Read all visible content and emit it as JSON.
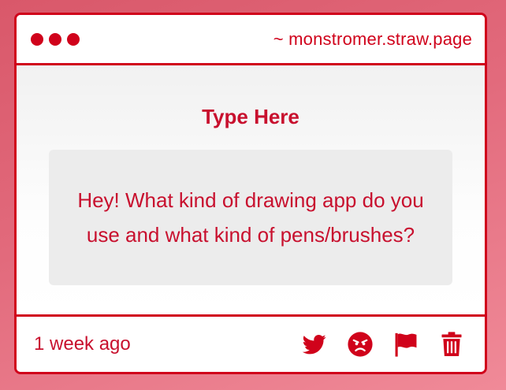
{
  "window": {
    "url": "~ monstromer.straw.page"
  },
  "main": {
    "heading": "Type Here",
    "message": "Hey! What kind of drawing app do you use and what kind of pens/brushes?"
  },
  "footer": {
    "timestamp": "1 week ago",
    "actions": [
      {
        "icon": "twitter-icon"
      },
      {
        "icon": "angry-face-icon"
      },
      {
        "icon": "flag-icon"
      },
      {
        "icon": "trash-icon"
      }
    ]
  },
  "colors": {
    "accent": "#d0021b",
    "text": "#c8102e",
    "message_bg": "#ececec"
  }
}
